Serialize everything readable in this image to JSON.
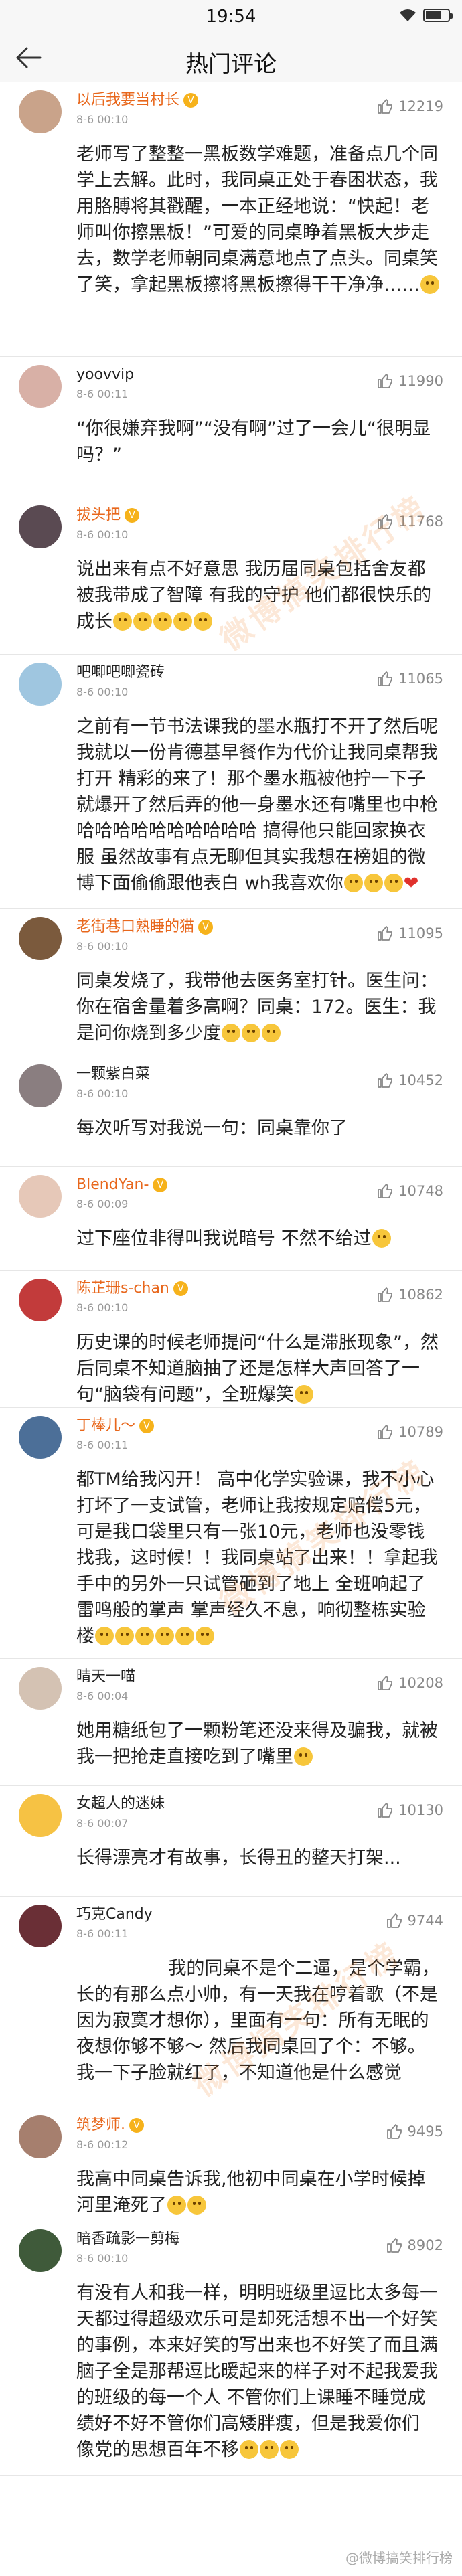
{
  "status": {
    "time": "19:54"
  },
  "nav": {
    "title": "热门评论"
  },
  "comments": [
    {
      "name": "以后我要当村长",
      "vip": true,
      "date": "8-6 00:10",
      "likes": "12219",
      "text": "老师写了整整一黑板数学难题，准备点几个同学上去解。此时，我同桌正处于春困状态，我用胳膊将其戳醒，一本正经地说：“快起！老师叫你擦黑板！”可爱的同桌睁着黑板大步走去，数学老师朝同桌满意地点了点头。同桌笑了笑，拿起黑板擦将黑板擦得干干净净……"
    },
    {
      "name": "yoovvip",
      "vip": false,
      "date": "8-6 00:11",
      "likes": "11990",
      "text": "“你很嫌弃我啊”“没有啊”过了一会儿“很明显吗？”"
    },
    {
      "name": "拔头把",
      "vip": true,
      "date": "8-6 00:10",
      "likes": "11768",
      "text": "说出来有点不好意思 我历届同桌包括舍友都被我带成了智障 有我的守护 他们都很快乐的成长"
    },
    {
      "name": "吧唧吧唧瓷砖",
      "vip": false,
      "date": "8-6 00:10",
      "likes": "11065",
      "text": "之前有一节书法课我的墨水瓶打不开了然后呢我就以一份肯德基早餐作为代价让我同桌帮我打开 精彩的来了！那个墨水瓶被他拧一下子就爆开了然后弄的他一身墨水还有嘴里也中枪哈哈哈哈哈哈哈哈哈哈 搞得他只能回家换衣服 虽然故事有点无聊但其实我想在榜姐的微博下面偷偷跟他表白 wh我喜欢你"
    },
    {
      "name": "老街巷口熟睡的猫",
      "vip": true,
      "date": "8-6 00:10",
      "likes": "11095",
      "text": "同桌发烧了，我带他去医务室打针。医生问：你在宿舍量着多高啊？同桌：172。医生：我是问你烧到多少度"
    },
    {
      "name": "一颗紫白菜",
      "vip": false,
      "date": "8-6 00:10",
      "likes": "10452",
      "text": "每次听写对我说一句：同桌靠你了"
    },
    {
      "name": "BlendYan-",
      "vip": true,
      "date": "8-6 00:09",
      "likes": "10748",
      "text": "过下座位非得叫我说暗号 不然不给过"
    },
    {
      "name": "陈芷珊s-chan",
      "vip": true,
      "date": "8-6 00:10",
      "likes": "10862",
      "text": "历史课的时候老师提问“什么是滞胀现象”，然后同桌不知道脑抽了还是怎样大声回答了一句“脑袋有问题”，全班爆笑"
    },
    {
      "name": "丁棒儿～",
      "vip": true,
      "date": "8-6 00:11",
      "likes": "10789",
      "text": "都TM给我闪开！ 高中化学实验课，我不小心打坏了一支试管，老师让我按规定赔偿5元，可是我口袋里只有一张10元，老师也没零钱找我，这时候！！我同桌站了出来！！拿起我手中的另外一只试管砸到了地上 全班响起了雷鸣般的掌声 掌声经久不息，响彻整栋实验楼"
    },
    {
      "name": "晴天一喵",
      "vip": false,
      "date": "8-6 00:04",
      "likes": "10208",
      "text": "她用糖纸包了一颗粉笔还没来得及骗我，就被我一把抢走直接吃到了嘴里"
    },
    {
      "name": "女超人的迷妹",
      "vip": false,
      "date": "8-6 00:07",
      "likes": "10130",
      "text": "长得漂亮才有故事，长得丑的整天打架..."
    },
    {
      "name": "巧克Candy",
      "vip": false,
      "date": "8-6 00:11",
      "likes": "9744",
      "text": "                我的同桌不是个二逼，是个学霸，长的有那么点小帅，有一天我在哼着歌（不是因为寂寞才想你），里面有一句：所有无眠的夜想你够不够～ 然后我同桌回了个：不够。我一下子脸就红了，不知道他是什么感觉"
    },
    {
      "name": "筑梦师.",
      "vip": true,
      "date": "8-6 00:12",
      "likes": "9495",
      "text": "我高中同桌告诉我,他初中同桌在小学时候掉河里淹死了"
    },
    {
      "name": "暗香疏影一剪梅",
      "vip": false,
      "date": "8-6 00:10",
      "likes": "8902",
      "text": "有没有人和我一样，明明班级里逗比太多每一天都过得超级欢乐可是却死活想不出一个好笑的事例，本来好笑的写出来也不好笑了而且满脑子全是那帮逗比暖起来的样子对不起我爱我的班级的每一个人 不管你们上课睡不睡觉成绩好不好不管你们高矮胖瘦，但是我爱你们 像党的思想百年不移"
    }
  ],
  "watermarks": {
    "text": "微博搞笑排行榜",
    "footer": "@微博搞笑排行榜"
  }
}
